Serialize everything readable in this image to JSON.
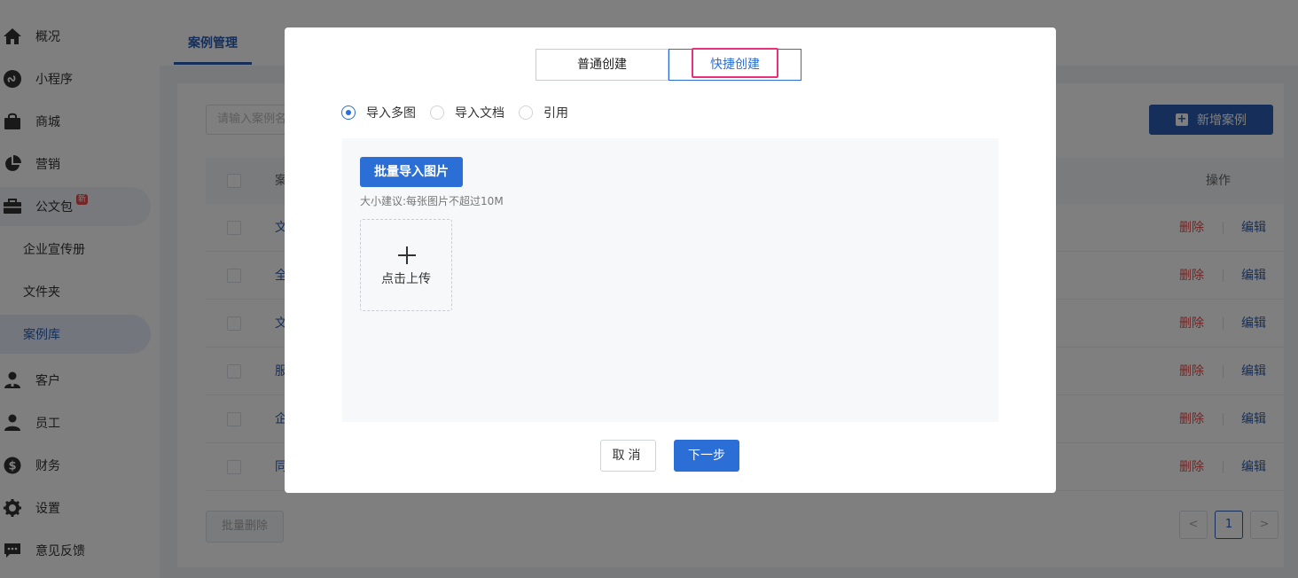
{
  "sidebar": {
    "items": [
      {
        "label": "概况",
        "icon": "home-icon"
      },
      {
        "label": "小程序",
        "icon": "mini-program-icon"
      },
      {
        "label": "商城",
        "icon": "shopping-bag-icon"
      },
      {
        "label": "营销",
        "icon": "pie-chart-icon"
      },
      {
        "label": "公文包",
        "icon": "briefcase-icon",
        "badge": "新"
      },
      {
        "label": "客户",
        "icon": "customer-icon"
      },
      {
        "label": "员工",
        "icon": "user-icon"
      },
      {
        "label": "财务",
        "icon": "dollar-icon"
      },
      {
        "label": "设置",
        "icon": "gear-icon"
      },
      {
        "label": "意见反馈",
        "icon": "feedback-icon"
      }
    ],
    "sub_items": [
      {
        "label": "企业宣传册"
      },
      {
        "label": "文件夹"
      },
      {
        "label": "案例库"
      }
    ]
  },
  "main": {
    "tab": "案例管理",
    "search_placeholder": "请输入案例名",
    "add_button": "新增案例",
    "column_prefix": "案",
    "operations_header": "操作",
    "rows": [
      {
        "name": "文"
      },
      {
        "name": "全"
      },
      {
        "name": "文"
      },
      {
        "name": "服"
      },
      {
        "name": "企"
      },
      {
        "name": "同"
      }
    ],
    "delete_label": "删除",
    "edit_label": "编辑",
    "batch_delete": "批量删除",
    "pager": {
      "prev": "<",
      "current": "1",
      "next": ">"
    }
  },
  "modal": {
    "tabs": [
      {
        "label": "普通创建"
      },
      {
        "label": "快捷创建"
      }
    ],
    "radios": [
      {
        "label": "导入多图"
      },
      {
        "label": "导入文档"
      },
      {
        "label": "引用"
      }
    ],
    "import_button": "批量导入图片",
    "hint": "大小建议:每张图片不超过10M",
    "upload_label": "点击上传",
    "cancel": "取消",
    "next": "下一步"
  },
  "colors": {
    "primary": "#2b6fd6",
    "sidebar_active": "#2b5fb4",
    "danger": "#e84a4a",
    "highlight": "#e8317a"
  }
}
